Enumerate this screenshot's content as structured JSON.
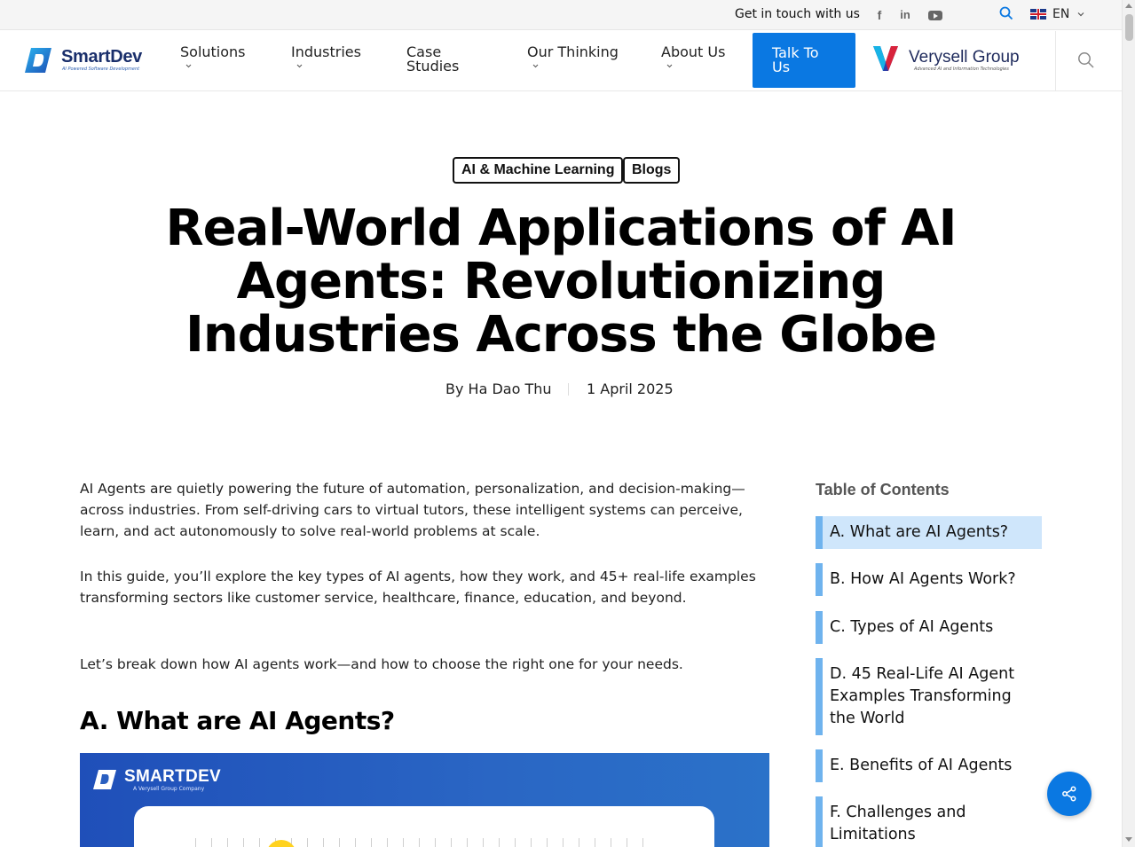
{
  "topbar": {
    "contact_label": "Get in touch with us",
    "social": [
      "facebook-icon",
      "linkedin-icon",
      "youtube-icon"
    ],
    "language": "EN"
  },
  "header": {
    "logo_name": "SmartDev",
    "logo_tagline": "AI Powered Software Development",
    "nav": [
      {
        "label": "Solutions",
        "dropdown": true
      },
      {
        "label": "Industries",
        "dropdown": true
      },
      {
        "label": "Case Studies",
        "dropdown": false
      },
      {
        "label": "Our Thinking",
        "dropdown": true
      },
      {
        "label": "About Us",
        "dropdown": true
      }
    ],
    "cta_label": "Talk To Us",
    "partner_name": "Verysell Group",
    "partner_tagline": "Advanced AI and Information Technologies",
    "accent_color": "#0a78e2"
  },
  "article": {
    "tags": [
      "AI & Machine Learning",
      "Blogs"
    ],
    "title": "Real-World Applications of AI Agents: Revolutionizing Industries Across the Globe",
    "author": "By Ha Dao Thu",
    "date": "1 April 2025",
    "paragraphs": [
      "AI Agents are quietly powering the future of automation, personalization, and decision-making—across industries. From self-driving cars to virtual tutors, these intelligent systems can perceive, learn, and act autonomously to solve real-world problems at scale.",
      "In this guide, you’ll explore the key types of AI agents, how they work, and 45+ real-life examples transforming sectors like customer service, healthcare, finance, education, and beyond.",
      "Let’s break down how AI agents work—and how to choose the right one for your needs."
    ],
    "section_heading": "A. What are AI Agents?",
    "hero_brand": "SMARTDEV",
    "hero_tagline": "A Verysell Group Company"
  },
  "toc": {
    "title": "Table of Contents",
    "items": [
      {
        "label": "A. What are AI Agents?",
        "active": true
      },
      {
        "label": "B. How AI Agents Work?",
        "active": false
      },
      {
        "label": "C. Types of AI Agents",
        "active": false
      },
      {
        "label": "D. 45 Real-Life AI Agent Examples Transforming the World",
        "active": false
      },
      {
        "label": "E. Benefits of AI Agents",
        "active": false
      },
      {
        "label": "F. Challenges and Limitations",
        "active": false
      }
    ]
  }
}
